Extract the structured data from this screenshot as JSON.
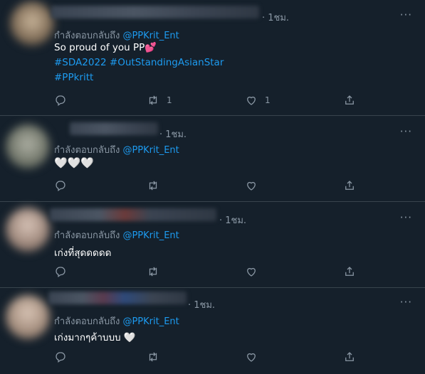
{
  "tweets": [
    {
      "time": "· 1ชม.",
      "reply_prefix": "กำลังตอบกลับถึง",
      "reply_handle": "@PPKrit_Ent",
      "text": "So proud of you PP💕",
      "hashtags": [
        "#SDA2022 #OutStandingAsianStar",
        "#PPkritt"
      ],
      "retweets": "1",
      "likes": "1"
    },
    {
      "time": "· 1ชม.",
      "reply_prefix": "กำลังตอบกลับถึง",
      "reply_handle": "@PPKrit_Ent",
      "text": "🤍🤍🤍",
      "hashtags": [],
      "retweets": "",
      "likes": ""
    },
    {
      "time": "· 1ชม.",
      "reply_prefix": "กำลังตอบกลับถึง",
      "reply_handle": "@PPKrit_Ent",
      "text": "เก่งที่สุดดดดด",
      "hashtags": [],
      "retweets": "",
      "likes": ""
    },
    {
      "time": "· 1ชม.",
      "reply_prefix": "กำลังตอบกลับถึง",
      "reply_handle": "@PPKrit_Ent",
      "text": "เก่งมากๆค้าบบบ 🤍",
      "hashtags": [],
      "retweets": "",
      "likes": ""
    }
  ],
  "more_label": "···",
  "colors": {
    "background": "#15202b",
    "accent": "#1d9bf0",
    "secondary_text": "#8b98a5",
    "divider": "#38444d"
  },
  "icons": [
    "reply-icon",
    "retweet-icon",
    "like-icon",
    "share-icon",
    "more-icon"
  ]
}
